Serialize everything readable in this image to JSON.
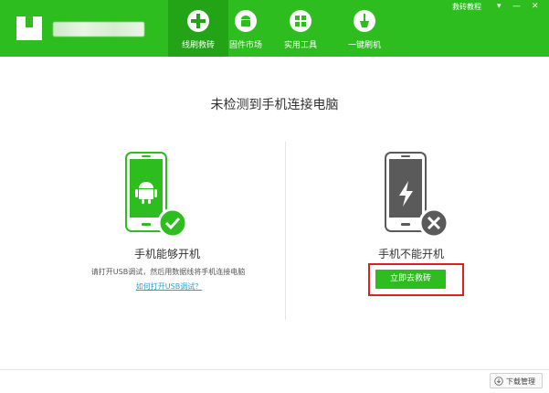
{
  "header": {
    "nav": [
      {
        "label": "线刷救砖",
        "icon": "plus-circle-icon",
        "active": true
      },
      {
        "label": "固件市场",
        "icon": "android-icon",
        "active": false
      },
      {
        "label": "实用工具",
        "icon": "grid-icon",
        "active": false
      },
      {
        "label": "一键刷机",
        "icon": "broom-icon",
        "active": false
      }
    ],
    "tutorial_link": "救砖教程",
    "window_controls": {
      "menu": "▾",
      "minimize": "—",
      "close": "✕"
    }
  },
  "main": {
    "title": "未检测到手机连接电脑",
    "left": {
      "status": "手机能够开机",
      "hint": "请打开USB调试，然后用数据线将手机连接电脑",
      "help_link": "如何打开USB调试？"
    },
    "right": {
      "status": "手机不能开机",
      "button": "立即去救砖"
    }
  },
  "footer": {
    "download_button": "下载管理"
  },
  "colors": {
    "brand": "#2ebd1f",
    "highlight": "#e02020",
    "link": "#2aa0d8"
  }
}
